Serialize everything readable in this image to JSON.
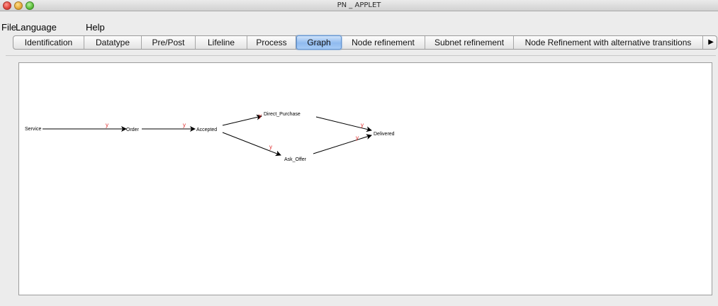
{
  "window": {
    "title": "PN _ APPLET"
  },
  "menu": {
    "items": [
      "File",
      "Language",
      "Help"
    ]
  },
  "tabs": {
    "items": [
      "Identification",
      "Datatype",
      "Pre/Post",
      "Lifeline",
      "Process",
      "Graph",
      "Node refinement",
      "Subnet refinement",
      "Node Refinement with alternative transitions"
    ],
    "selected": "Graph",
    "overflow_icon": "triangle-right-icon"
  },
  "graph": {
    "nodes": [
      "Service",
      "Order",
      "Accepted",
      "Direct_Purchase",
      "Ask_Offer",
      "Delivered"
    ],
    "arcs": [
      {
        "from": "Service",
        "to": "Order",
        "label": "y"
      },
      {
        "from": "Order",
        "to": "Accepted",
        "label": "y"
      },
      {
        "from": "Accepted",
        "to": "Direct_Purchase",
        "label": "y"
      },
      {
        "from": "Accepted",
        "to": "Ask_Offer",
        "label": "y"
      },
      {
        "from": "Direct_Purchase",
        "to": "Delivered",
        "label": "y"
      },
      {
        "from": "Ask_Offer",
        "to": "Delivered",
        "label": "y"
      }
    ],
    "arc_label_color": "#dd2222"
  },
  "colors": {
    "selected_tab": "#8fbaf0",
    "close": "#e0443a",
    "minimize": "#e6a93a",
    "maximize": "#5cbf3a"
  }
}
